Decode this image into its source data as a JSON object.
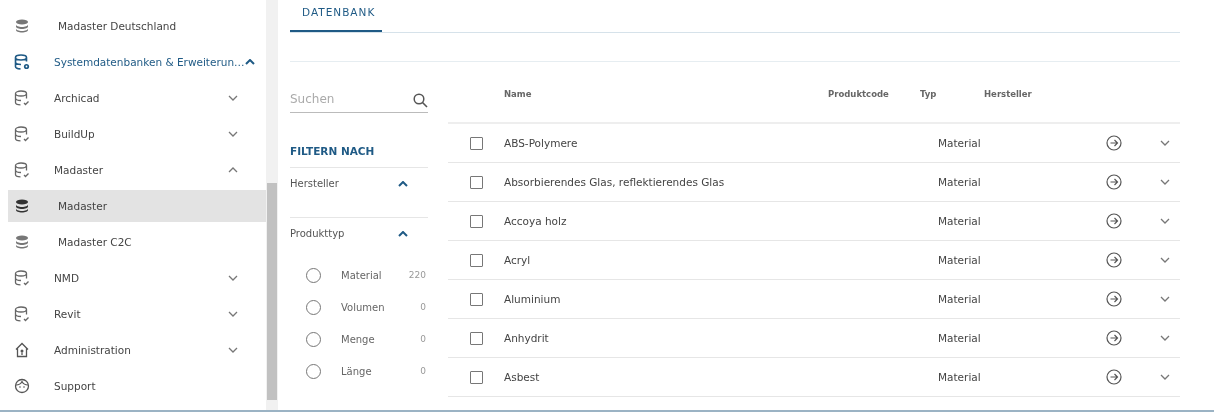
{
  "sidebar": {
    "items": [
      {
        "label": "Madaster Deutschland",
        "kind": "plain",
        "selected": false
      },
      {
        "label": "Systemdatenbanken & Erweiterun…",
        "kind": "system",
        "selected": false,
        "expanded": true,
        "children": [
          {
            "label": "Archicad",
            "kind": "linked",
            "selected": false,
            "expanded": false
          },
          {
            "label": "BuildUp",
            "kind": "linked",
            "selected": false,
            "expanded": false
          },
          {
            "label": "Madaster",
            "kind": "linked",
            "selected": false,
            "expanded": true,
            "children": [
              {
                "label": "Madaster",
                "kind": "plain",
                "selected": true
              },
              {
                "label": "Madaster C2C",
                "kind": "plain",
                "selected": false
              }
            ]
          },
          {
            "label": "NMD",
            "kind": "linked",
            "selected": false,
            "expanded": false
          },
          {
            "label": "Revit",
            "kind": "linked",
            "selected": false,
            "expanded": false
          }
        ]
      },
      {
        "label": "Administration",
        "kind": "home",
        "selected": false,
        "expanded": false
      },
      {
        "label": "Support",
        "kind": "help",
        "selected": false
      }
    ]
  },
  "tabs": [
    {
      "label": "DATENBANK",
      "selected": true
    }
  ],
  "filters": {
    "search": {
      "placeholder": "Suchen"
    },
    "title": "FILTERN NACH",
    "groups": [
      {
        "label": "Hersteller",
        "expanded": true
      },
      {
        "label": "Produkttyp",
        "expanded": true,
        "options": [
          {
            "label": "Material",
            "count": "220",
            "selected": false
          },
          {
            "label": "Volumen",
            "count": "0",
            "selected": false
          },
          {
            "label": "Menge",
            "count": "0",
            "selected": false
          },
          {
            "label": "Länge",
            "count": "0",
            "selected": false
          }
        ]
      }
    ]
  },
  "table": {
    "columns": [
      "Name",
      "Produktcode",
      "Typ",
      "Hersteller"
    ],
    "rows": [
      {
        "name": "ABS-Polymere",
        "type": "Material",
        "checked": false
      },
      {
        "name": "Absorbierendes Glas, reflektierendes Glas",
        "type": "Material",
        "checked": false
      },
      {
        "name": "Accoya holz",
        "type": "Material",
        "checked": false
      },
      {
        "name": "Acryl",
        "type": "Material",
        "checked": false
      },
      {
        "name": "Aluminium",
        "type": "Material",
        "checked": false
      },
      {
        "name": "Anhydrit",
        "type": "Material",
        "checked": false
      },
      {
        "name": "Asbest",
        "type": "Material",
        "checked": false
      }
    ]
  }
}
